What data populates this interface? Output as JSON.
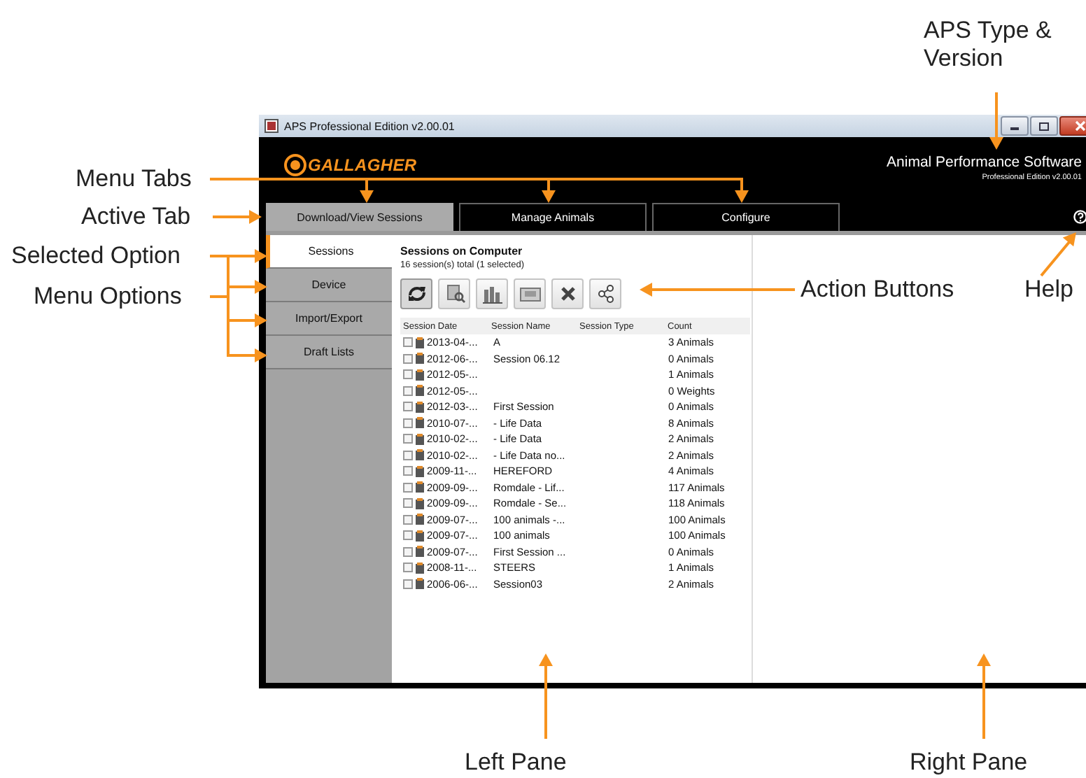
{
  "annotations": [
    {
      "text": "APS Type & Version"
    },
    {
      "text": "Menu Tabs"
    },
    {
      "text": "Active Tab"
    },
    {
      "text": "Selected Option"
    },
    {
      "text": "Menu Options"
    },
    {
      "text": "Action Buttons"
    },
    {
      "text": "Help"
    },
    {
      "text": "Left Pane"
    },
    {
      "text": "Right Pane"
    }
  ],
  "window": {
    "title": "APS Professional Edition v2.00.01"
  },
  "header": {
    "logo": "GALLAGHER",
    "product": "Animal Performance Software",
    "edition": "Professional Edition v2.00.01"
  },
  "tabs": [
    {
      "label": "Download/View Sessions",
      "selected": true
    },
    {
      "label": "Manage Animals",
      "selected": false
    },
    {
      "label": "Configure",
      "selected": false
    }
  ],
  "nav": [
    {
      "label": "Sessions",
      "selected": true
    },
    {
      "label": "Device",
      "selected": false
    },
    {
      "label": "Import/Export",
      "selected": false
    },
    {
      "label": "Draft Lists",
      "selected": false
    }
  ],
  "sessions": {
    "title": "Sessions on Computer",
    "summary": "16 session(s) total (1 selected)",
    "columns": [
      "Session Date",
      "Session Name",
      "Session Type",
      "Count"
    ],
    "rows": [
      {
        "checked": false,
        "date": "2013-04-...",
        "name": "A",
        "count": "3 Animals"
      },
      {
        "checked": false,
        "date": "2012-06-...",
        "name": "Session 06.12",
        "count": "0 Animals"
      },
      {
        "checked": false,
        "date": "2012-05-...",
        "count": "1 Animals"
      },
      {
        "checked": false,
        "date": "2012-05-...",
        "count": "0 Weights"
      },
      {
        "checked": false,
        "date": "2012-03-...",
        "name": "First Session",
        "count": "0 Animals"
      },
      {
        "checked": false,
        "date": "2010-07-...",
        "name": "- Life Data",
        "count": "8 Animals"
      },
      {
        "checked": false,
        "date": "2010-02-...",
        "name": "- Life Data",
        "count": "2 Animals"
      },
      {
        "checked": false,
        "date": "2010-02-...",
        "name": "- Life Data no...",
        "count": "2 Animals"
      },
      {
        "checked": false,
        "date": "2009-11-...",
        "name": "HEREFORD",
        "count": "4 Animals"
      },
      {
        "checked": false,
        "date": "2009-09-...",
        "name": "Romdale - Lif...",
        "count": "117 Animals"
      },
      {
        "checked": false,
        "date": "2009-09-...",
        "name": "Romdale - Se...",
        "count": "118 Animals"
      },
      {
        "checked": false,
        "date": "2009-07-...",
        "name": "100 animals -...",
        "count": "100 Animals"
      },
      {
        "checked": false,
        "date": "2009-07-...",
        "name": "100 animals",
        "count": "100 Animals"
      },
      {
        "checked": false,
        "date": "2009-07-...",
        "name": "First Session ...",
        "count": "0 Animals"
      },
      {
        "checked": false,
        "date": "2008-11-...",
        "name": "STEERS",
        "count": "1 Animals"
      },
      {
        "checked": false,
        "date": "2006-06-...",
        "name": "Session03",
        "count": "2 Animals"
      }
    ]
  }
}
